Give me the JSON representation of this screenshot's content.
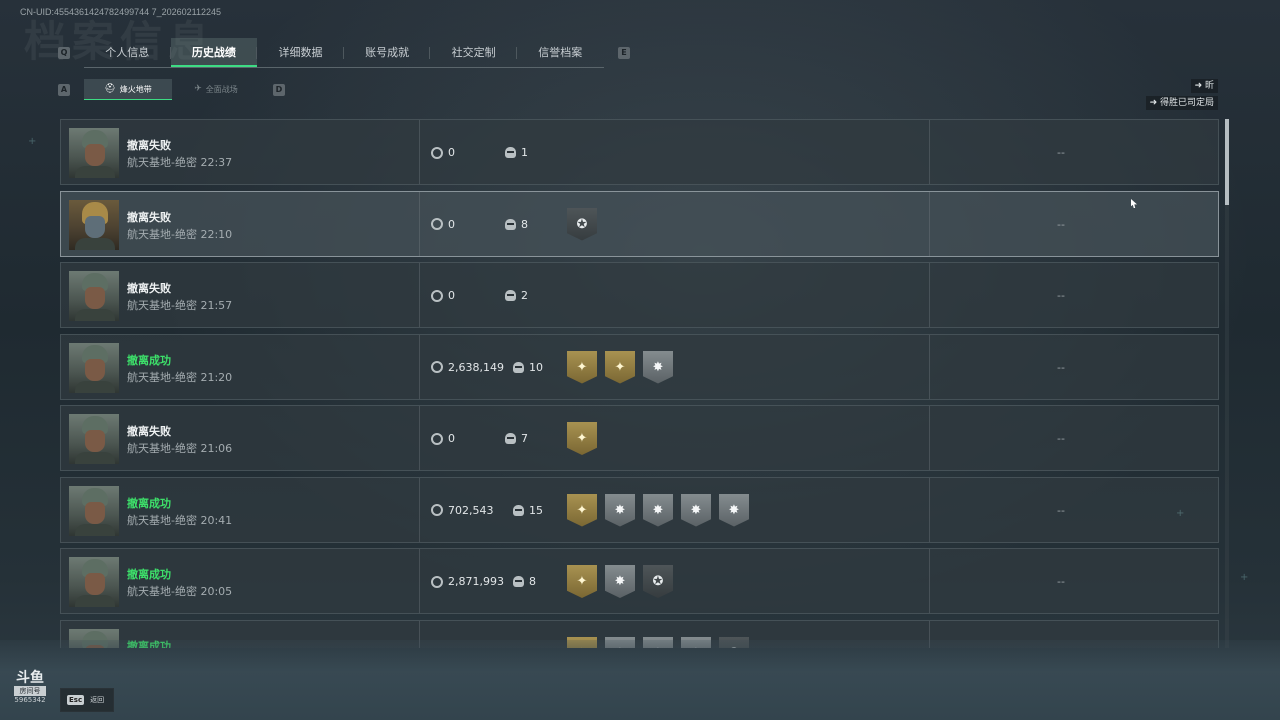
{
  "header": {
    "uid": "CN-UID:4554361424782499744 7_202602112245",
    "bg_title": "档案信息",
    "key_prev": "Q",
    "key_next": "E",
    "sub_key_prev": "A",
    "sub_key_next": "D"
  },
  "tabs": [
    {
      "label": "个人信息",
      "active": false
    },
    {
      "label": "历史战绩",
      "active": true
    },
    {
      "label": "详细数据",
      "active": false
    },
    {
      "label": "账号成就",
      "active": false
    },
    {
      "label": "社交定制",
      "active": false
    },
    {
      "label": "信誉档案",
      "active": false
    }
  ],
  "subtabs": [
    {
      "label": "烽火地带",
      "icon": "⛑",
      "active": true
    },
    {
      "label": "全面战场",
      "icon": "✈",
      "active": false
    }
  ],
  "sort": {
    "primary": "昕",
    "secondary": "得胜已司定局"
  },
  "matches": [
    {
      "result": "撤离失败",
      "success": false,
      "location": "航天基地-绝密 22:37",
      "value": "0",
      "kills": "1",
      "badges": [],
      "extra": "--",
      "avatar": "normal"
    },
    {
      "result": "撤离失败",
      "success": false,
      "location": "航天基地-绝密 22:10",
      "value": "0",
      "kills": "8",
      "badges": [
        "dark"
      ],
      "extra": "--",
      "avatar": "gold"
    },
    {
      "result": "撤离失败",
      "success": false,
      "location": "航天基地-绝密 21:57",
      "value": "0",
      "kills": "2",
      "badges": [],
      "extra": "--",
      "avatar": "normal"
    },
    {
      "result": "撤离成功",
      "success": true,
      "location": "航天基地-绝密 21:20",
      "value": "2,638,149",
      "kills": "10",
      "badges": [
        "gold",
        "gold",
        "silver"
      ],
      "extra": "--",
      "avatar": "normal"
    },
    {
      "result": "撤离失败",
      "success": false,
      "location": "航天基地-绝密 21:06",
      "value": "0",
      "kills": "7",
      "badges": [
        "gold"
      ],
      "extra": "--",
      "avatar": "normal"
    },
    {
      "result": "撤离成功",
      "success": true,
      "location": "航天基地-绝密 20:41",
      "value": "702,543",
      "kills": "15",
      "badges": [
        "gold",
        "silver",
        "silver",
        "silver",
        "silver"
      ],
      "extra": "--",
      "avatar": "normal"
    },
    {
      "result": "撤离成功",
      "success": true,
      "location": "航天基地-绝密 20:05",
      "value": "2,871,993",
      "kills": "8",
      "badges": [
        "gold",
        "silver",
        "dark"
      ],
      "extra": "--",
      "avatar": "normal"
    },
    {
      "result": "撤离成功",
      "success": true,
      "location": "",
      "value": "",
      "kills": "",
      "badges": [
        "gold",
        "silver",
        "silver",
        "silver",
        "dark"
      ],
      "extra": "",
      "avatar": "normal"
    }
  ],
  "footer": {
    "esc_key": "Esc",
    "esc_label": "返回",
    "stream_logo": "斗鱼",
    "stream_sub": "房间号",
    "stream_room": "5965342"
  },
  "colors": {
    "accent_green": "#3ddc84",
    "success_text": "#3de06a",
    "badge_gold": "#a89251",
    "badge_silver": "#848c8f"
  }
}
